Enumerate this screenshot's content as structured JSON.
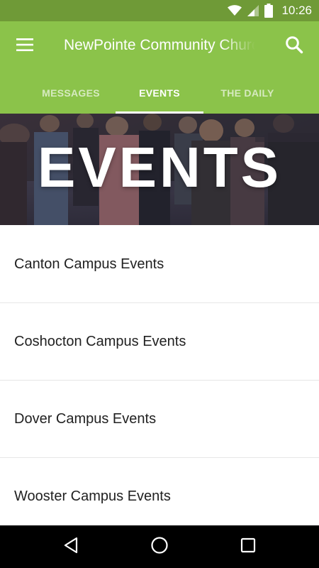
{
  "status_bar": {
    "time": "10:26",
    "icons": [
      "wifi-icon",
      "cell-signal-icon",
      "battery-icon"
    ]
  },
  "app_bar": {
    "title": "NewPointe Community Church",
    "menu_icon": "hamburger-menu-icon",
    "search_icon": "search-icon",
    "background_color": "#8bc34a"
  },
  "tabs": [
    {
      "label": "MESSAGES",
      "active": false
    },
    {
      "label": "EVENTS",
      "active": true
    },
    {
      "label": "THE DAILY",
      "active": false
    }
  ],
  "hero": {
    "title": "EVENTS"
  },
  "events": [
    {
      "label": "Canton Campus Events"
    },
    {
      "label": "Coshocton Campus Events"
    },
    {
      "label": "Dover Campus Events"
    },
    {
      "label": "Wooster Campus Events"
    }
  ],
  "nav_bar": {
    "icons": [
      "back-icon",
      "home-icon",
      "recents-icon"
    ]
  }
}
